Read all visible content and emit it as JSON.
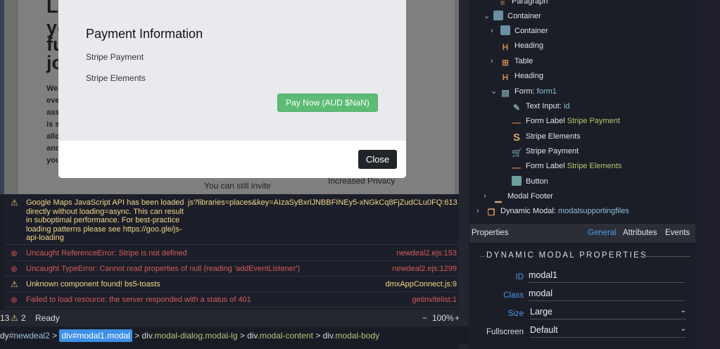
{
  "background_page": {
    "heading_fragments": [
      "Lo",
      "yo",
      "fu",
      "jo"
    ],
    "para_fragments": [
      "We",
      "eve",
      "ass",
      "is s",
      "allo",
      "and",
      "you"
    ],
    "col1": "You can still invite",
    "col2": "Increased Privacy"
  },
  "modal": {
    "title": "Payment Information",
    "label1": "Stripe Payment",
    "label2": "Stripe Elements",
    "pay_button": "Pay Now (AUD $NaN)",
    "close_button": "Close"
  },
  "console": [
    {
      "level": "warning",
      "message": "Google Maps JavaScript API has been loaded directly without loading=async. This can result in suboptimal performance. For best-practice loading patterns please see https://goo.gle/js-api-loading",
      "source": "js?libraries=places&key=AIzaSyBxrlJNBBFINEy5-xNGkCq8FjZudCLu0FQ:613"
    },
    {
      "level": "error",
      "message": "Uncaught ReferenceError: Stripe is not defined",
      "source": "newdeal2.ejs:153"
    },
    {
      "level": "error",
      "message": "Uncaught TypeError: Cannot read properties of null (reading 'addEventListener')",
      "source": "newdeal2.ejs:1299"
    },
    {
      "level": "warning",
      "message": "Unknown component found! bs5-toasts",
      "source": "dmxAppConnect.js:9"
    },
    {
      "level": "error",
      "message": "Failed to load resource: the server responded with a status of 401",
      "source": "getinvitelist:1"
    }
  ],
  "status": {
    "errors": "13",
    "warnings": "2",
    "state": "Ready",
    "zoom": "100%",
    "minus": "−",
    "plus": "+"
  },
  "breadcrumb": [
    {
      "tag": "dy",
      "rest": "#newdeal2"
    },
    {
      "tag": "div",
      "rest": "#modal1.modal"
    },
    {
      "tag": "div",
      "rest": ".modal-dialog.modal-lg"
    },
    {
      "tag": "div",
      "rest": ".modal-content"
    },
    {
      "tag": "div",
      "rest": ".modal-body"
    }
  ],
  "tree": [
    {
      "label": "Paragraph",
      "suffix": ""
    },
    {
      "label": "Container",
      "suffix": ""
    },
    {
      "label": "Container",
      "suffix": ""
    },
    {
      "label": "Heading",
      "suffix": ""
    },
    {
      "label": "Table",
      "suffix": ""
    },
    {
      "label": "Heading",
      "suffix": ""
    },
    {
      "label": "Form: ",
      "suffix": "form1"
    },
    {
      "label": "Text Input: ",
      "suffix": "id"
    },
    {
      "label": "Form Label ",
      "suffix": "Stripe Payment"
    },
    {
      "label": "Stripe Elements",
      "suffix": ""
    },
    {
      "label": "Stripe Payment",
      "suffix": ""
    },
    {
      "label": "Form Label ",
      "suffix": "Stripe Elements"
    },
    {
      "label": "Button",
      "suffix": ""
    },
    {
      "label": "Modal Footer",
      "suffix": ""
    },
    {
      "label": "Dynamic Modal: ",
      "suffix": "modalsupportingfiles"
    }
  ],
  "properties": {
    "title": "Properties",
    "tabs": [
      "General",
      "Attributes",
      "Events"
    ],
    "active_tab": "General",
    "section": "DYNAMIC MODAL PROPERTIES",
    "fields": [
      {
        "label": "ID",
        "value": "modal1"
      },
      {
        "label": "Class",
        "value": "modal"
      },
      {
        "label": "Size",
        "value": "Large"
      },
      {
        "label": "Fullscreen",
        "value": "Default"
      }
    ]
  }
}
